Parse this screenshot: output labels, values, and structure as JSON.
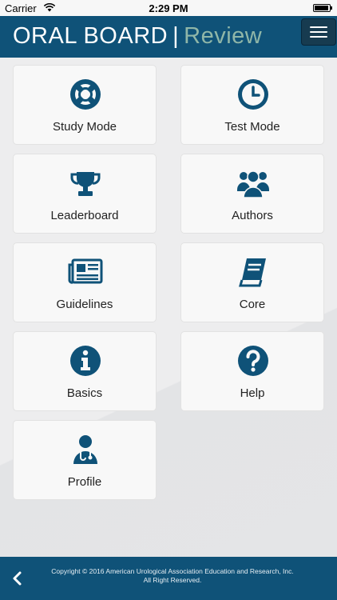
{
  "status_bar": {
    "carrier": "Carrier",
    "time": "2:29 PM"
  },
  "header": {
    "logo_left": "ORAL BOARD",
    "logo_separator": "|",
    "logo_right": "Review"
  },
  "tiles": [
    {
      "label": "Study Mode",
      "icon": "lifebuoy-icon"
    },
    {
      "label": "Test Mode",
      "icon": "clock-icon"
    },
    {
      "label": "Leaderboard",
      "icon": "trophy-icon"
    },
    {
      "label": "Authors",
      "icon": "users-icon"
    },
    {
      "label": "Guidelines",
      "icon": "newspaper-icon"
    },
    {
      "label": "Core",
      "icon": "book-icon"
    },
    {
      "label": "Basics",
      "icon": "info-icon"
    },
    {
      "label": "Help",
      "icon": "help-icon"
    },
    {
      "label": "Profile",
      "icon": "doctor-icon"
    }
  ],
  "footer": {
    "copyright_line1": "Copyright © 2016 American Urological Association Education and Research, Inc.",
    "copyright_line2": "All Right Reserved."
  },
  "colors": {
    "primary": "#0f5278",
    "icon": "#0f5278",
    "logo_accent": "#8fb6a8",
    "tile_bg": "#f8f8f8"
  }
}
